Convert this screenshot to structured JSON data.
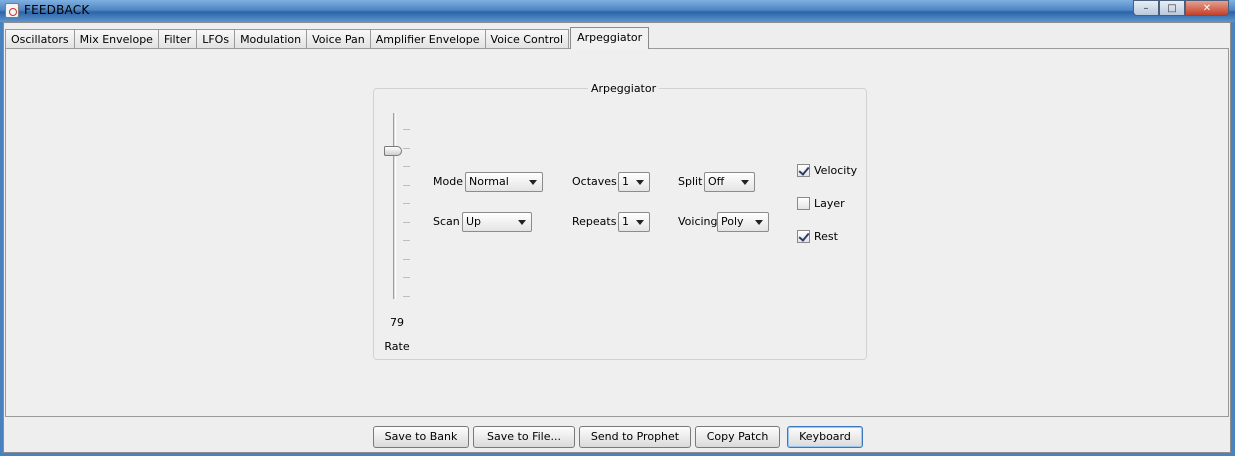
{
  "window": {
    "title": "FEEDBACK",
    "min_symbol": "–",
    "max_symbol": "□",
    "close_symbol": "✕"
  },
  "tabs": [
    {
      "label": "Oscillators"
    },
    {
      "label": "Mix Envelope"
    },
    {
      "label": "Filter"
    },
    {
      "label": "LFOs"
    },
    {
      "label": "Modulation"
    },
    {
      "label": "Voice Pan"
    },
    {
      "label": "Amplifier Envelope"
    },
    {
      "label": "Voice Control"
    },
    {
      "label": "Arpeggiator",
      "selected": true
    }
  ],
  "arpeggiator": {
    "title": "Arpeggiator",
    "rate": {
      "label": "Rate",
      "value": "79"
    },
    "mode": {
      "label": "Mode",
      "value": "Normal"
    },
    "scan": {
      "label": "Scan",
      "value": "Up"
    },
    "octaves": {
      "label": "Octaves",
      "value": "1"
    },
    "repeats": {
      "label": "Repeats",
      "value": "1"
    },
    "split": {
      "label": "Split",
      "value": "Off"
    },
    "voicing": {
      "label": "Voicing",
      "value": "Poly"
    },
    "velocity": {
      "label": "Velocity",
      "checked": true
    },
    "layer": {
      "label": "Layer",
      "checked": false
    },
    "rest": {
      "label": "Rest",
      "checked": true
    }
  },
  "buttons": {
    "save_to_bank": "Save to Bank",
    "save_to_file": "Save to File...",
    "send_to_prophet": "Send to Prophet",
    "copy_patch": "Copy Patch",
    "keyboard": "Keyboard"
  }
}
